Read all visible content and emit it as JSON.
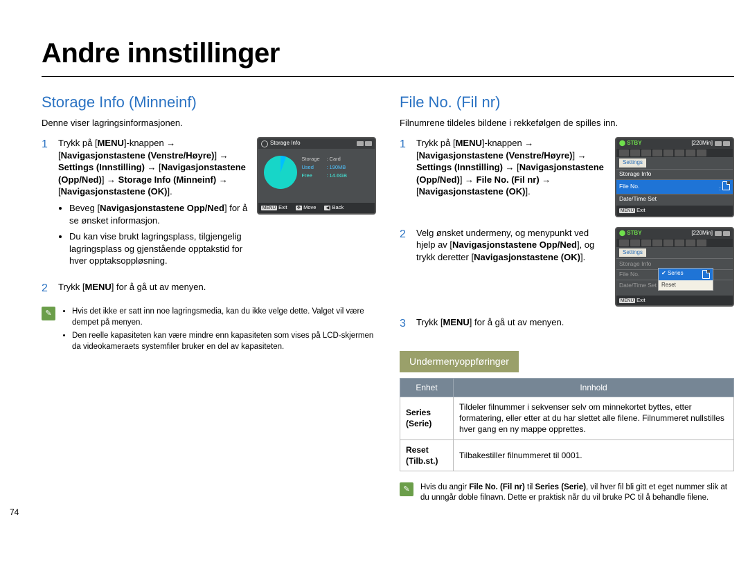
{
  "title": "Andre innstillinger",
  "pageNumber": "74",
  "left": {
    "heading": "Storage Info (Minneinf)",
    "lead": "Denne viser lagringsinformasjonen.",
    "step1_a": "Trykk på [",
    "step1_menu": "MENU",
    "step1_b": "]-knappen → [",
    "step1_c": "Navigasjonstastene (Venstre/Høyre)",
    "step1_d": "] → ",
    "step1_e": "Settings (Innstilling)",
    "step1_f": " → [",
    "step1_g": "Navigasjonstastene (Opp/Ned)",
    "step1_h": "] → ",
    "step1_i": "Storage Info (Minneinf)",
    "step1_j": " → [",
    "step1_k": "Navigasjonstastene (OK)",
    "step1_l": "].",
    "bullet1_a": "Beveg [",
    "bullet1_b": "Navigasjonstastene Opp/Ned",
    "bullet1_c": "] for å se ønsket informasjon.",
    "bullet2": "Du kan vise brukt lagringsplass, tilgjengelig lagringsplass og gjenstående opptakstid for hver opptaksoppløsning.",
    "step2_a": "Trykk [",
    "step2_b": "MENU",
    "step2_c": "] for å gå ut av menyen.",
    "note1": "Hvis det ikke er satt inn noe lagringsmedia, kan du ikke velge dette. Valget vil være dempet på menyen.",
    "note2": "Den reelle kapasiteten kan være mindre enn kapasiteten som vises på LCD-skjermen da videokameraets systemfiler bruker en del av kapasiteten.",
    "screen": {
      "title": "Storage Info",
      "storageLabel": "Storage",
      "storageVal": ": Card",
      "usedLabel": "Used",
      "usedVal": ": 190MB",
      "freeLabel": "Free",
      "freeVal": ": 14.6GB",
      "exit": "Exit",
      "move": "Move",
      "back": "Back",
      "menu": "MENU"
    }
  },
  "right": {
    "heading": "File No. (Fil nr)",
    "lead": "Filnumrene tildeles bildene i rekkefølgen de spilles inn.",
    "step1_a": "Trykk på [",
    "step1_menu": "MENU",
    "step1_b": "]-knappen → [",
    "step1_c": "Navigasjonstastene (Venstre/Høyre)",
    "step1_d": "] → ",
    "step1_e": "Settings (Innstilling)",
    "step1_f": " → [",
    "step1_g": "Navigasjonstastene (Opp/Ned)",
    "step1_h": "] → ",
    "step1_i": "File No. (Fil nr)",
    "step1_j": " → [",
    "step1_k": "Navigasjonstastene (OK)",
    "step1_l": "].",
    "step2_a": "Velg ønsket undermeny, og menypunkt ved hjelp av [",
    "step2_b": "Navigasjonstastene Opp/Ned",
    "step2_c": "], og trykk deretter [",
    "step2_d": "Navigasjonstastene (OK)",
    "step2_e": "].",
    "step3_a": "Trykk [",
    "step3_b": "MENU",
    "step3_c": "] for å gå ut av menyen.",
    "screen1": {
      "stby": "STBY",
      "time": "[220Min]",
      "settings": "Settings",
      "row1": "Storage Info",
      "row2": "File No.",
      "row3": "Date/Time Set",
      "exit": "Exit",
      "menu": "MENU"
    },
    "screen2": {
      "stby": "STBY",
      "time": "[220Min]",
      "settings": "Settings",
      "row1": "Storage Info",
      "row2": "File No.",
      "row3": "Date/Time Set",
      "popup1": "Series",
      "popup2": "Reset",
      "exit": "Exit",
      "menu": "MENU"
    },
    "subheading": "Undermenyoppføringer",
    "table": {
      "h1": "Enhet",
      "h2": "Innhold",
      "r1a": "Series",
      "r1a2": "(Serie)",
      "r1b": "Tildeler filnummer i sekvenser selv om minnekortet byttes, etter formatering, eller etter at du har slettet alle filene. Filnummeret nullstilles hver gang en ny mappe opprettes.",
      "r2a": "Reset",
      "r2a2": "(Tilb.st.)",
      "r2b": "Tilbakestiller filnummeret til 0001."
    },
    "note_a": "Hvis du angir ",
    "note_b": "File No. (Fil nr)",
    "note_c": " til ",
    "note_d": "Series (Serie)",
    "note_e": ", vil hver fil bli gitt et eget nummer slik at du unngår doble filnavn. Dette er praktisk når du vil bruke PC til å behandle filene."
  }
}
